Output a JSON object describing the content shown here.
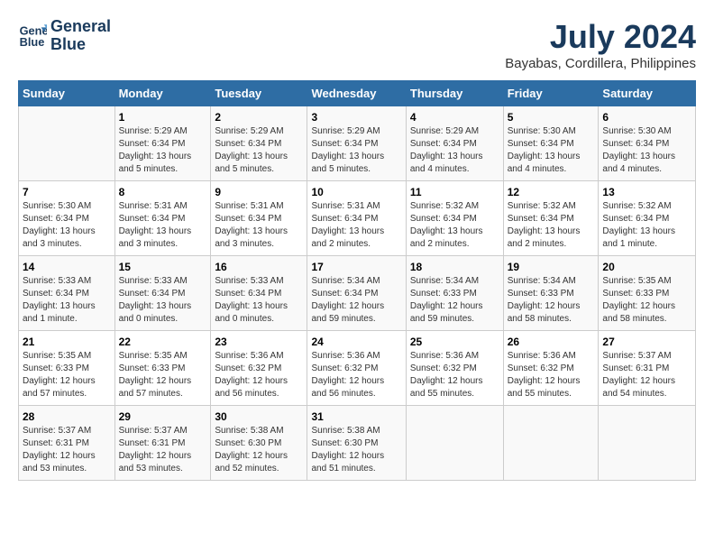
{
  "header": {
    "logo_line1": "General",
    "logo_line2": "Blue",
    "month_year": "July 2024",
    "location": "Bayabas, Cordillera, Philippines"
  },
  "days_of_week": [
    "Sunday",
    "Monday",
    "Tuesday",
    "Wednesday",
    "Thursday",
    "Friday",
    "Saturday"
  ],
  "weeks": [
    [
      {
        "day": "",
        "info": ""
      },
      {
        "day": "1",
        "info": "Sunrise: 5:29 AM\nSunset: 6:34 PM\nDaylight: 13 hours\nand 5 minutes."
      },
      {
        "day": "2",
        "info": "Sunrise: 5:29 AM\nSunset: 6:34 PM\nDaylight: 13 hours\nand 5 minutes."
      },
      {
        "day": "3",
        "info": "Sunrise: 5:29 AM\nSunset: 6:34 PM\nDaylight: 13 hours\nand 5 minutes."
      },
      {
        "day": "4",
        "info": "Sunrise: 5:29 AM\nSunset: 6:34 PM\nDaylight: 13 hours\nand 4 minutes."
      },
      {
        "day": "5",
        "info": "Sunrise: 5:30 AM\nSunset: 6:34 PM\nDaylight: 13 hours\nand 4 minutes."
      },
      {
        "day": "6",
        "info": "Sunrise: 5:30 AM\nSunset: 6:34 PM\nDaylight: 13 hours\nand 4 minutes."
      }
    ],
    [
      {
        "day": "7",
        "info": "Sunrise: 5:30 AM\nSunset: 6:34 PM\nDaylight: 13 hours\nand 3 minutes."
      },
      {
        "day": "8",
        "info": "Sunrise: 5:31 AM\nSunset: 6:34 PM\nDaylight: 13 hours\nand 3 minutes."
      },
      {
        "day": "9",
        "info": "Sunrise: 5:31 AM\nSunset: 6:34 PM\nDaylight: 13 hours\nand 3 minutes."
      },
      {
        "day": "10",
        "info": "Sunrise: 5:31 AM\nSunset: 6:34 PM\nDaylight: 13 hours\nand 2 minutes."
      },
      {
        "day": "11",
        "info": "Sunrise: 5:32 AM\nSunset: 6:34 PM\nDaylight: 13 hours\nand 2 minutes."
      },
      {
        "day": "12",
        "info": "Sunrise: 5:32 AM\nSunset: 6:34 PM\nDaylight: 13 hours\nand 2 minutes."
      },
      {
        "day": "13",
        "info": "Sunrise: 5:32 AM\nSunset: 6:34 PM\nDaylight: 13 hours\nand 1 minute."
      }
    ],
    [
      {
        "day": "14",
        "info": "Sunrise: 5:33 AM\nSunset: 6:34 PM\nDaylight: 13 hours\nand 1 minute."
      },
      {
        "day": "15",
        "info": "Sunrise: 5:33 AM\nSunset: 6:34 PM\nDaylight: 13 hours\nand 0 minutes."
      },
      {
        "day": "16",
        "info": "Sunrise: 5:33 AM\nSunset: 6:34 PM\nDaylight: 13 hours\nand 0 minutes."
      },
      {
        "day": "17",
        "info": "Sunrise: 5:34 AM\nSunset: 6:34 PM\nDaylight: 12 hours\nand 59 minutes."
      },
      {
        "day": "18",
        "info": "Sunrise: 5:34 AM\nSunset: 6:33 PM\nDaylight: 12 hours\nand 59 minutes."
      },
      {
        "day": "19",
        "info": "Sunrise: 5:34 AM\nSunset: 6:33 PM\nDaylight: 12 hours\nand 58 minutes."
      },
      {
        "day": "20",
        "info": "Sunrise: 5:35 AM\nSunset: 6:33 PM\nDaylight: 12 hours\nand 58 minutes."
      }
    ],
    [
      {
        "day": "21",
        "info": "Sunrise: 5:35 AM\nSunset: 6:33 PM\nDaylight: 12 hours\nand 57 minutes."
      },
      {
        "day": "22",
        "info": "Sunrise: 5:35 AM\nSunset: 6:33 PM\nDaylight: 12 hours\nand 57 minutes."
      },
      {
        "day": "23",
        "info": "Sunrise: 5:36 AM\nSunset: 6:32 PM\nDaylight: 12 hours\nand 56 minutes."
      },
      {
        "day": "24",
        "info": "Sunrise: 5:36 AM\nSunset: 6:32 PM\nDaylight: 12 hours\nand 56 minutes."
      },
      {
        "day": "25",
        "info": "Sunrise: 5:36 AM\nSunset: 6:32 PM\nDaylight: 12 hours\nand 55 minutes."
      },
      {
        "day": "26",
        "info": "Sunrise: 5:36 AM\nSunset: 6:32 PM\nDaylight: 12 hours\nand 55 minutes."
      },
      {
        "day": "27",
        "info": "Sunrise: 5:37 AM\nSunset: 6:31 PM\nDaylight: 12 hours\nand 54 minutes."
      }
    ],
    [
      {
        "day": "28",
        "info": "Sunrise: 5:37 AM\nSunset: 6:31 PM\nDaylight: 12 hours\nand 53 minutes."
      },
      {
        "day": "29",
        "info": "Sunrise: 5:37 AM\nSunset: 6:31 PM\nDaylight: 12 hours\nand 53 minutes."
      },
      {
        "day": "30",
        "info": "Sunrise: 5:38 AM\nSunset: 6:30 PM\nDaylight: 12 hours\nand 52 minutes."
      },
      {
        "day": "31",
        "info": "Sunrise: 5:38 AM\nSunset: 6:30 PM\nDaylight: 12 hours\nand 51 minutes."
      },
      {
        "day": "",
        "info": ""
      },
      {
        "day": "",
        "info": ""
      },
      {
        "day": "",
        "info": ""
      }
    ]
  ]
}
